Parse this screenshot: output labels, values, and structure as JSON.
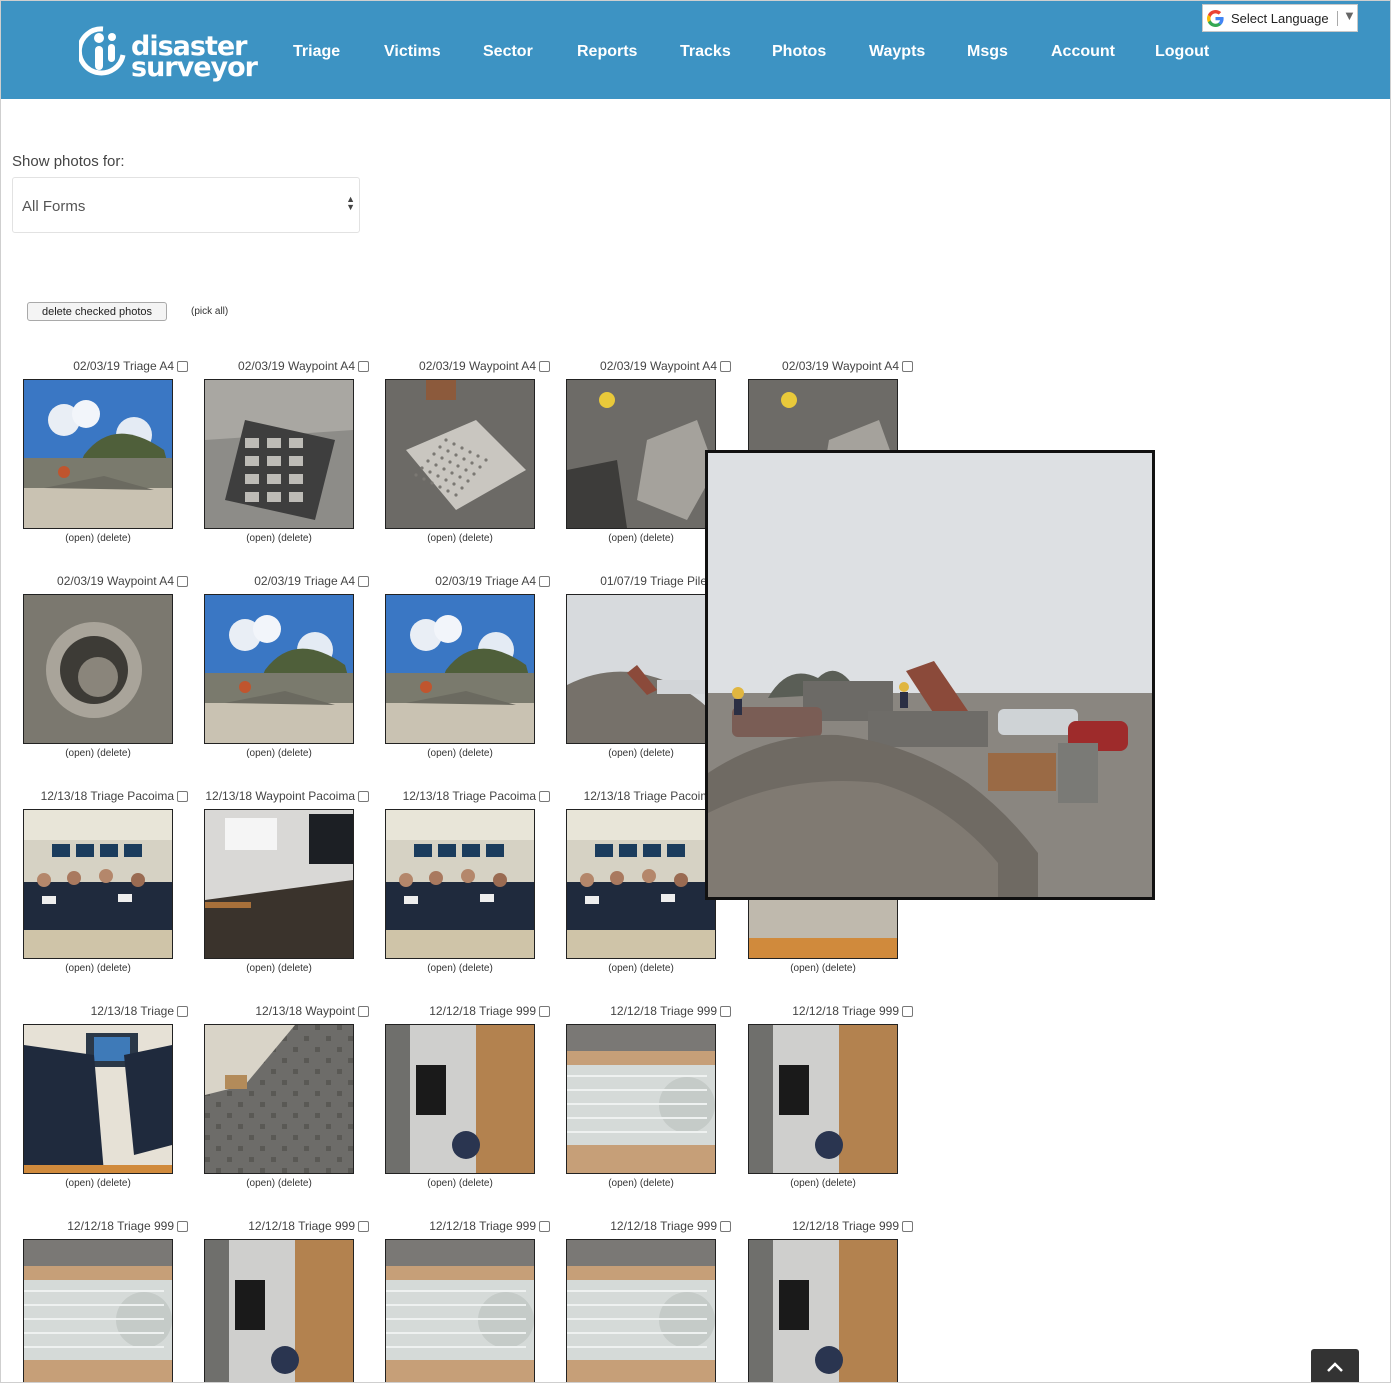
{
  "header": {
    "logo_line1": "disaster",
    "logo_line2": "surveyor",
    "nav": [
      "Triage",
      "Victims",
      "Sector",
      "Reports",
      "Tracks",
      "Photos",
      "Waypts",
      "Msgs",
      "Account",
      "Logout"
    ],
    "language": "Select Language",
    "language_arrow": "▼",
    "bg_color": "#3d93c3"
  },
  "filter": {
    "label": "Show photos for:",
    "selected": "All Forms"
  },
  "actions": {
    "delete_checked": "delete checked photos",
    "pick_all": "(pick all)"
  },
  "photo_links": {
    "open": "(open)",
    "delete": "(delete)"
  },
  "photos": [
    {
      "caption": "02/03/19 Triage A4",
      "scene": "rubble-sky"
    },
    {
      "caption": "02/03/19 Waypoint A4",
      "scene": "grate"
    },
    {
      "caption": "02/03/19 Waypoint A4",
      "scene": "lattice"
    },
    {
      "caption": "02/03/19 Waypoint A4",
      "scene": "rocks"
    },
    {
      "caption": "02/03/19 Waypoint A4",
      "scene": "rocks"
    },
    {
      "caption": "02/03/19 Waypoint A4",
      "scene": "pipe"
    },
    {
      "caption": "02/03/19 Triage A4",
      "scene": "rubble-sky"
    },
    {
      "caption": "02/03/19 Triage A4",
      "scene": "rubble-sky"
    },
    {
      "caption": "01/07/19 Triage Pile 1",
      "scene": "pile"
    },
    {
      "caption": "",
      "scene": "pile"
    },
    {
      "caption": "12/13/18 Triage Pacoima",
      "scene": "classroom"
    },
    {
      "caption": "12/13/18 Waypoint Pacoima",
      "scene": "empty-room"
    },
    {
      "caption": "12/13/18 Triage Pacoima",
      "scene": "classroom"
    },
    {
      "caption": "12/13/18 Triage Pacoima",
      "scene": "classroom"
    },
    {
      "caption": "",
      "scene": "table"
    },
    {
      "caption": "12/13/18 Triage",
      "scene": "shirt"
    },
    {
      "caption": "12/13/18 Waypoint",
      "scene": "carpet"
    },
    {
      "caption": "12/12/18 Triage 999",
      "scene": "rotated-room"
    },
    {
      "caption": "12/12/18 Triage 999",
      "scene": "glass"
    },
    {
      "caption": "12/12/18 Triage 999",
      "scene": "rotated-room"
    },
    {
      "caption": "12/12/18 Triage 999",
      "scene": "glass"
    },
    {
      "caption": "12/12/18 Triage 999",
      "scene": "rotated-room"
    },
    {
      "caption": "12/12/18 Triage 999",
      "scene": "glass"
    },
    {
      "caption": "12/12/18 Triage 999",
      "scene": "glass"
    },
    {
      "caption": "12/12/18 Triage 999",
      "scene": "rotated-room"
    }
  ],
  "popup": {
    "scene": "pile-large"
  },
  "scroll_top_icon": "chevron-up-icon"
}
